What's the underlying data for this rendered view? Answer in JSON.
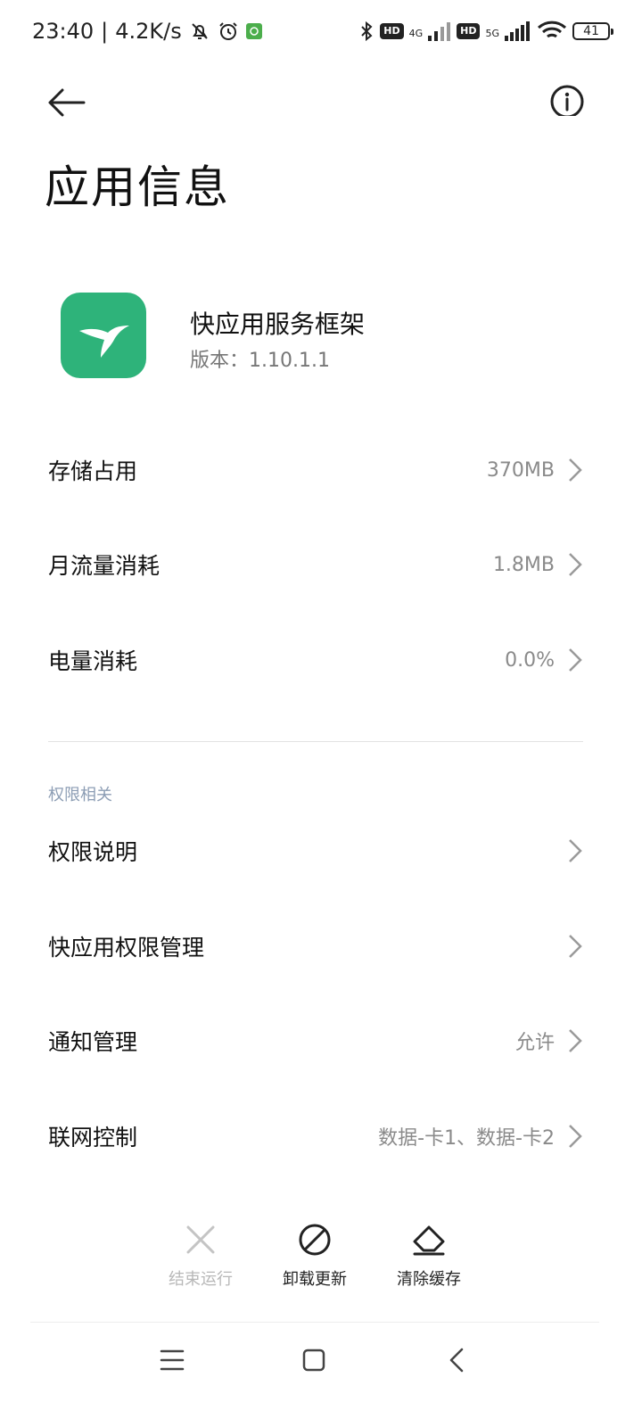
{
  "status_bar": {
    "time": "23:40",
    "separator": "|",
    "net_speed": "4.2K/s",
    "hd1": "HD",
    "net1": "4G",
    "hd2": "HD",
    "net2": "5G",
    "battery": "41"
  },
  "header": {
    "title": "应用信息"
  },
  "app": {
    "name": "快应用服务框架",
    "version": "版本：1.10.1.1",
    "icon_color": "#2eb37a"
  },
  "rows_usage": [
    {
      "label": "存储占用",
      "value": "370MB"
    },
    {
      "label": "月流量消耗",
      "value": "1.8MB"
    },
    {
      "label": "电量消耗",
      "value": "0.0%"
    }
  ],
  "permissions": {
    "section_title": "权限相关",
    "rows": [
      {
        "label": "权限说明",
        "value": ""
      },
      {
        "label": "快应用权限管理",
        "value": ""
      },
      {
        "label": "通知管理",
        "value": "允许"
      },
      {
        "label": "联网控制",
        "value": "数据-卡1、数据-卡2"
      }
    ]
  },
  "actions": {
    "stop": "结束运行",
    "uninstall_updates": "卸载更新",
    "clear_cache": "清除缓存"
  },
  "icons": {
    "back": "arrow-left-icon",
    "info": "info-icon",
    "chevron": "chevron-right-icon",
    "stop": "close-icon",
    "uninstall": "block-icon",
    "clear": "eraser-icon"
  },
  "colors": {
    "accent_section": "#8c9db4",
    "muted_text": "#8a8a8a",
    "disabled_text": "#b8b8b8"
  }
}
